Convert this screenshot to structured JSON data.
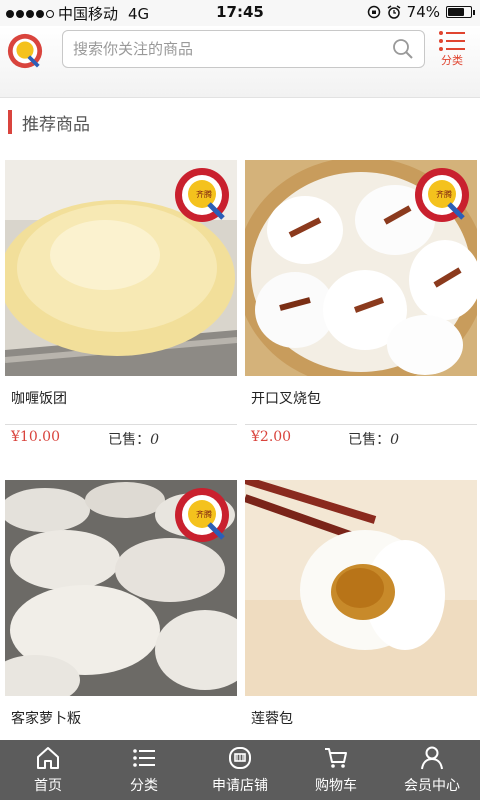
{
  "status_bar": {
    "carrier": "中国移动",
    "network": "4G",
    "time": "17:45",
    "battery": "74%",
    "battery_level": 0.74
  },
  "header": {
    "search_placeholder": "搜索你关注的商品",
    "category_label": "分类"
  },
  "section": {
    "title": "推荐商品"
  },
  "products": [
    {
      "name": "咖喱饭团",
      "price": "¥10.00",
      "sold_label": "已售：",
      "sold_count": "0",
      "badge_text": "齐腾"
    },
    {
      "name": "开口叉烧包",
      "price": "¥2.00",
      "sold_label": "已售：",
      "sold_count": "0",
      "badge_text": "齐腾"
    },
    {
      "name": "客家萝卜粄",
      "badge_text": "齐腾"
    },
    {
      "name": "莲蓉包"
    }
  ],
  "tabbar": {
    "items": [
      {
        "label": "首页",
        "icon": "home-icon"
      },
      {
        "label": "分类",
        "icon": "list-icon"
      },
      {
        "label": "申请店铺",
        "icon": "shop-icon"
      },
      {
        "label": "购物车",
        "icon": "cart-icon"
      },
      {
        "label": "会员中心",
        "icon": "user-icon"
      }
    ]
  },
  "colors": {
    "accent": "#d9443d",
    "tabbar": "#5c5c5c"
  }
}
